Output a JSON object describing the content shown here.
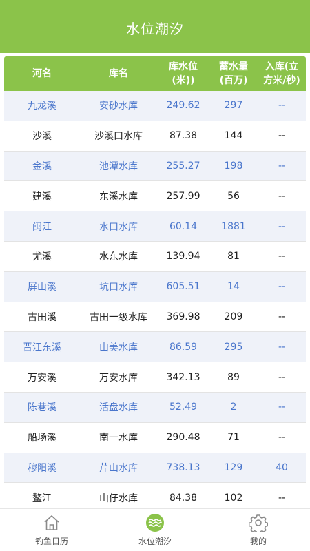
{
  "header": {
    "title": "水位潮汐"
  },
  "table": {
    "columns": [
      "河名",
      "库名",
      "库水位(米))",
      "蓄水量(百万)",
      "入库(立方米/秒)"
    ],
    "rows": [
      [
        "九龙溪",
        "安砂水库",
        "249.62",
        "297",
        "--"
      ],
      [
        "沙溪",
        "沙溪口水库",
        "87.38",
        "144",
        "--"
      ],
      [
        "金溪",
        "池潭水库",
        "255.27",
        "198",
        "--"
      ],
      [
        "建溪",
        "东溪水库",
        "257.99",
        "56",
        "--"
      ],
      [
        "闽江",
        "水口水库",
        "60.14",
        "1881",
        "--"
      ],
      [
        "尤溪",
        "水东水库",
        "139.94",
        "81",
        "--"
      ],
      [
        "屏山溪",
        "坑口水库",
        "605.51",
        "14",
        "--"
      ],
      [
        "古田溪",
        "古田一级水库",
        "369.98",
        "209",
        "--"
      ],
      [
        "晋江东溪",
        "山美水库",
        "86.59",
        "295",
        "--"
      ],
      [
        "万安溪",
        "万安水库",
        "342.13",
        "89",
        "--"
      ],
      [
        "陈巷溪",
        "活盘水库",
        "52.49",
        "2",
        "--"
      ],
      [
        "船场溪",
        "南一水库",
        "290.48",
        "71",
        "--"
      ],
      [
        "穆阳溪",
        "芹山水库",
        "738.13",
        "129",
        "40"
      ],
      [
        "鳌江",
        "山仔水库",
        "84.38",
        "102",
        "--"
      ],
      [
        "",
        "",
        "",
        "",
        ""
      ]
    ]
  },
  "tabbar": {
    "items": [
      {
        "label": "钓鱼日历",
        "icon": "home-icon"
      },
      {
        "label": "水位潮汐",
        "icon": "waves-icon"
      },
      {
        "label": "我的",
        "icon": "gear-icon"
      }
    ],
    "active_index": 1
  },
  "colors": {
    "accent": "#8bc34a",
    "blue_text": "#4a76cc",
    "odd_row_bg": "#eff2f9"
  }
}
